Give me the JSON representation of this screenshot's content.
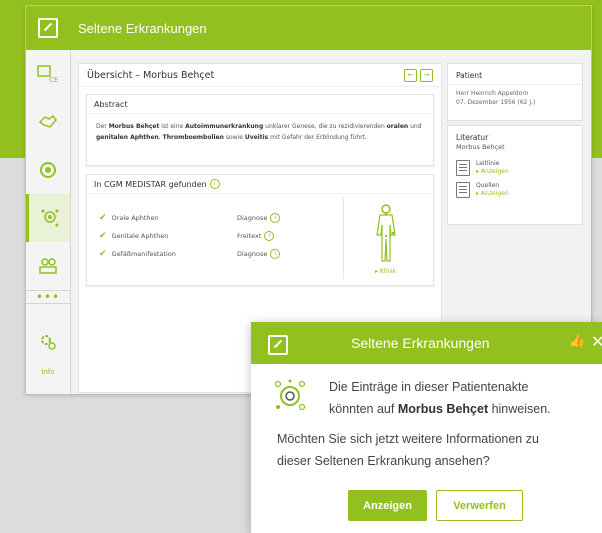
{
  "app": {
    "title": "Seltene Erkrankungen"
  },
  "sidebar": {
    "items": [
      {
        "icon": "ce-device-icon"
      },
      {
        "icon": "handshake-icon"
      },
      {
        "icon": "cg-icon"
      },
      {
        "icon": "patient-scan-icon"
      },
      {
        "icon": "people-icon"
      },
      {
        "icon": "settings-icon"
      }
    ],
    "more": "•••",
    "info": "Info"
  },
  "main": {
    "title": "Übersicht – Morbus Behçet",
    "nav_prev": "←",
    "nav_next": "→",
    "abstract": {
      "heading": "Abstract",
      "text_1": "Der ",
      "text_b1": "Morbus Behçet",
      "text_2": " ist eine ",
      "text_b2": "Autoimmunerkrankung",
      "text_3": " unklarer Genese, die zu rezidivierenden ",
      "text_b3": "oralen",
      "text_4": " und ",
      "text_b4": "genitalen Aphthen",
      "text_5": ", ",
      "text_b5": "Thromboembolien",
      "text_6": " sowie ",
      "text_b6": "Uveitis",
      "text_7": " mit Gefahr der Erblindung führt."
    },
    "found": {
      "heading": "In CGM MEDISTAR gefunden",
      "info": "i",
      "items": [
        {
          "label": "Orale Aphthen",
          "type": "Diagnose"
        },
        {
          "label": "Genitale Aphthen",
          "type": "Freitext"
        },
        {
          "label": "Gefäßmanifestation",
          "type": "Diagnose"
        }
      ],
      "klinik": "▸ Klinik"
    }
  },
  "patient": {
    "heading": "Patient",
    "name": "Herr Heinrich Appeldorn",
    "dob": "07. Dezember 1956 (62 J.)"
  },
  "literatur": {
    "heading": "Literatur",
    "subtitle": "Morbus Behçet",
    "items": [
      {
        "label": "Leitlinie",
        "link": "▸ Anzeigen"
      },
      {
        "label": "Quellen",
        "link": "▸ Anzeigen"
      }
    ]
  },
  "popup": {
    "title": "Seltene Erkrankungen",
    "line1": "Die Einträge in dieser Patientenakte",
    "line2_a": "könnten auf ",
    "line2_b": "Morbus Behçet",
    "line2_c": " hinweisen.",
    "q1": "Möchten Sie sich jetzt weitere Informationen zu",
    "q2": "dieser Seltenen Erkrankung ansehen?",
    "show": "Anzeigen",
    "reject": "Verwerfen",
    "thumb": "👍",
    "close": "✕"
  }
}
